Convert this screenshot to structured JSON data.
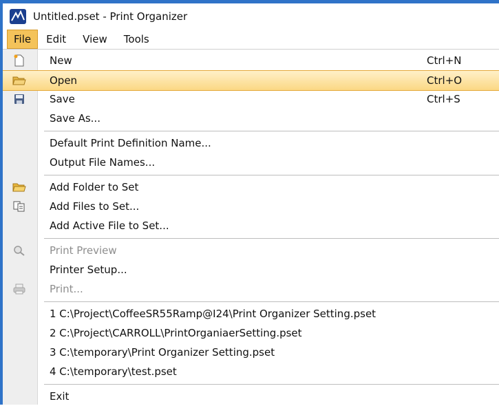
{
  "window": {
    "title": "Untitled.pset - Print Organizer"
  },
  "menubar": {
    "items": [
      "File",
      "Edit",
      "View",
      "Tools"
    ]
  },
  "file_menu": {
    "new": {
      "label": "New",
      "shortcut": "Ctrl+N",
      "icon": "new-document-icon"
    },
    "open": {
      "label": "Open",
      "shortcut": "Ctrl+O",
      "icon": "open-folder-icon"
    },
    "save": {
      "label": "Save",
      "shortcut": "Ctrl+S",
      "icon": "floppy-disk-icon"
    },
    "save_as": {
      "label": "Save As..."
    },
    "default_print_def": {
      "label": "Default Print Definition Name..."
    },
    "output_file_names": {
      "label": "Output File Names..."
    },
    "add_folder": {
      "label": "Add Folder to Set",
      "icon": "folder-icon"
    },
    "add_files": {
      "label": "Add Files to Set...",
      "icon": "add-files-icon"
    },
    "add_active_file": {
      "label": "Add Active File to Set..."
    },
    "print_preview": {
      "label": "Print Preview",
      "icon": "print-preview-icon",
      "enabled": false
    },
    "printer_setup": {
      "label": "Printer Setup..."
    },
    "print": {
      "label": "Print...",
      "icon": "printer-icon",
      "enabled": false
    },
    "recent": [
      "1 C:\\Project\\CoffeeSR55Ramp@I24\\Print Organizer Setting.pset",
      "2 C:\\Project\\CARROLL\\PrintOrganiaerSetting.pset",
      "3 C:\\temporary\\Print Organizer Setting.pset",
      "4 C:\\temporary\\test.pset"
    ],
    "exit": {
      "label": "Exit"
    }
  },
  "colors": {
    "highlight": "#fbd884",
    "window_border": "#2f73c8",
    "disabled_text": "#8e8e8e"
  }
}
